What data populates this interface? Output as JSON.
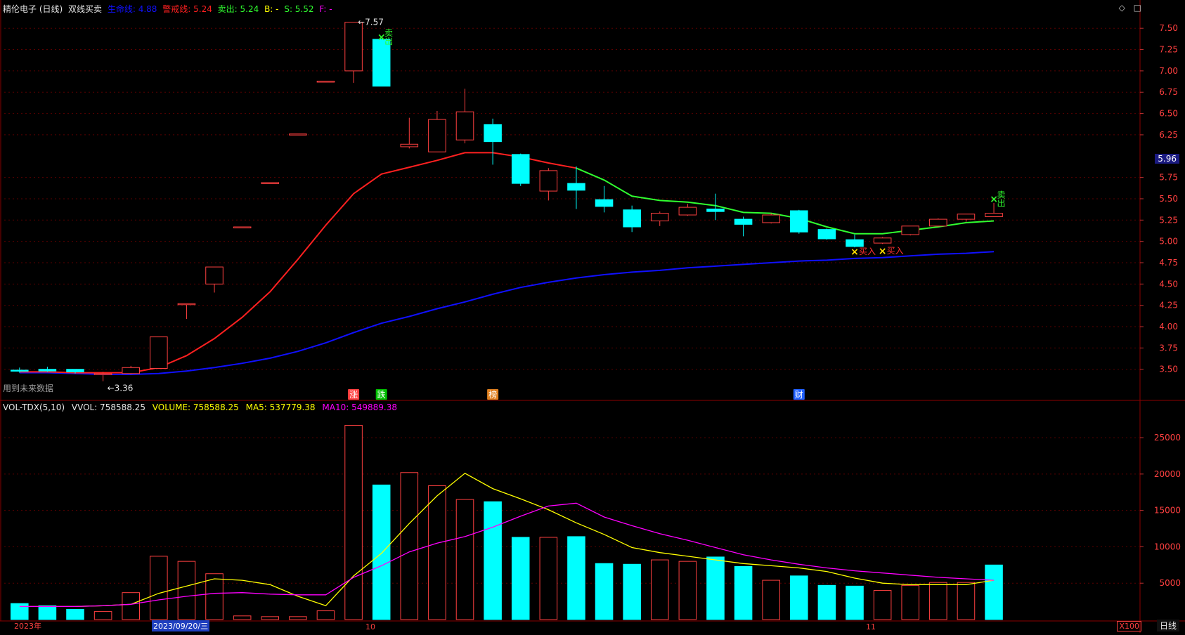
{
  "header": {
    "stock": "精伦电子 (日线)",
    "indicator": "双线买卖",
    "items": [
      {
        "label": "生命线: 4.88",
        "color": "#1010ff"
      },
      {
        "label": "警戒线: 5.24",
        "color": "#ff2020"
      },
      {
        "label": "卖出: 5.24",
        "color": "#30ff30"
      },
      {
        "label": "B: -",
        "color": "#ffff00"
      },
      {
        "label": "S: 5.52",
        "color": "#30ff30"
      },
      {
        "label": "F: -",
        "color": "#ff00ff"
      }
    ],
    "icons": [
      "diamond-icon",
      "square-icon"
    ]
  },
  "volume_header": {
    "name": "VOL-TDX(5,10)",
    "vvol": "VVOL: 758588.25",
    "volume": "VOLUME: 758588.25",
    "ma5": "MA5: 537779.38",
    "ma10": "MA10: 549889.38"
  },
  "note": "用到未来数据",
  "period": "日线",
  "scale": "X100",
  "current_price": "5.96",
  "dates": {
    "year": "2023年",
    "selected": "2023/09/20/三",
    "m10": "10",
    "m11": "11"
  },
  "colors": {
    "up": "#ff4040",
    "down": "#00ffff",
    "life_line": "#1010ff",
    "warn_red": "#ff2020",
    "warn_green": "#30ff30",
    "ma5": "#ffff00",
    "ma10": "#ff00ff"
  },
  "chart_data": [
    {
      "type": "candlestick",
      "ylim": [
        3.3,
        7.65
      ],
      "yticks": [
        "7.50",
        "7.25",
        "7.00",
        "6.75",
        "6.50",
        "6.25",
        "5.75",
        "5.50",
        "5.25",
        "5.00",
        "4.75",
        "4.50",
        "4.25",
        "4.00",
        "3.75",
        "3.50"
      ],
      "candles": [
        {
          "o": 3.49,
          "h": 3.52,
          "l": 3.46,
          "c": 3.48
        },
        {
          "o": 3.5,
          "h": 3.53,
          "l": 3.47,
          "c": 3.48
        },
        {
          "o": 3.5,
          "h": 3.5,
          "l": 3.45,
          "c": 3.47
        },
        {
          "o": 3.45,
          "h": 3.47,
          "l": 3.36,
          "c": 3.45
        },
        {
          "o": 3.45,
          "h": 3.54,
          "l": 3.44,
          "c": 3.52
        },
        {
          "o": 3.51,
          "h": 3.88,
          "l": 3.51,
          "c": 3.88
        },
        {
          "o": 4.27,
          "h": 4.27,
          "l": 4.09,
          "c": 4.27
        },
        {
          "o": 4.5,
          "h": 4.7,
          "l": 4.4,
          "c": 4.7
        },
        {
          "o": 5.17,
          "h": 5.17,
          "l": 5.17,
          "c": 5.17
        },
        {
          "o": 5.69,
          "h": 5.69,
          "l": 5.69,
          "c": 5.69
        },
        {
          "o": 6.26,
          "h": 6.26,
          "l": 6.26,
          "c": 6.26
        },
        {
          "o": 6.88,
          "h": 6.88,
          "l": 6.88,
          "c": 6.88
        },
        {
          "o": 7.0,
          "h": 7.57,
          "l": 6.86,
          "c": 7.57
        },
        {
          "o": 7.37,
          "h": 7.37,
          "l": 6.82,
          "c": 6.82
        },
        {
          "o": 6.11,
          "h": 6.45,
          "l": 6.09,
          "c": 6.14
        },
        {
          "o": 6.05,
          "h": 6.53,
          "l": 6.05,
          "c": 6.43
        },
        {
          "o": 6.19,
          "h": 6.79,
          "l": 6.15,
          "c": 6.52
        },
        {
          "o": 6.37,
          "h": 6.44,
          "l": 5.9,
          "c": 6.17
        },
        {
          "o": 6.02,
          "h": 6.03,
          "l": 5.65,
          "c": 5.68
        },
        {
          "o": 5.59,
          "h": 5.86,
          "l": 5.48,
          "c": 5.83
        },
        {
          "o": 5.68,
          "h": 5.88,
          "l": 5.38,
          "c": 5.6
        },
        {
          "o": 5.49,
          "h": 5.65,
          "l": 5.34,
          "c": 5.41
        },
        {
          "o": 5.37,
          "h": 5.42,
          "l": 5.11,
          "c": 5.17
        },
        {
          "o": 5.24,
          "h": 5.35,
          "l": 5.18,
          "c": 5.33
        },
        {
          "o": 5.31,
          "h": 5.44,
          "l": 5.3,
          "c": 5.4
        },
        {
          "o": 5.38,
          "h": 5.56,
          "l": 5.25,
          "c": 5.35
        },
        {
          "o": 5.26,
          "h": 5.29,
          "l": 5.06,
          "c": 5.2
        },
        {
          "o": 5.22,
          "h": 5.33,
          "l": 5.21,
          "c": 5.31
        },
        {
          "o": 5.36,
          "h": 5.37,
          "l": 5.09,
          "c": 5.11
        },
        {
          "o": 5.14,
          "h": 5.15,
          "l": 5.02,
          "c": 5.03
        },
        {
          "o": 5.02,
          "h": 5.08,
          "l": 4.93,
          "c": 4.94
        },
        {
          "o": 4.98,
          "h": 5.05,
          "l": 4.97,
          "c": 5.04
        },
        {
          "o": 5.08,
          "h": 5.18,
          "l": 5.07,
          "c": 5.18
        },
        {
          "o": 5.18,
          "h": 5.27,
          "l": 5.17,
          "c": 5.26
        },
        {
          "o": 5.26,
          "h": 5.32,
          "l": 5.23,
          "c": 5.32
        },
        {
          "o": 5.29,
          "h": 5.45,
          "l": 5.29,
          "c": 5.33
        }
      ],
      "series": [
        {
          "name": "生命线",
          "color": "#1010ff",
          "values": [
            3.46,
            3.46,
            3.45,
            3.44,
            3.44,
            3.45,
            3.48,
            3.52,
            3.57,
            3.63,
            3.71,
            3.81,
            3.93,
            4.04,
            4.12,
            4.21,
            4.29,
            4.38,
            4.46,
            4.52,
            4.57,
            4.61,
            4.64,
            4.66,
            4.69,
            4.71,
            4.73,
            4.75,
            4.77,
            4.78,
            4.8,
            4.81,
            4.83,
            4.85,
            4.86,
            4.88
          ]
        },
        {
          "name": "警戒线",
          "color": "#ff2020",
          "values": [
            3.47,
            3.47,
            3.46,
            3.46,
            3.46,
            3.52,
            3.66,
            3.86,
            4.11,
            4.41,
            4.79,
            5.19,
            5.56,
            5.79,
            5.87,
            5.95,
            6.04,
            6.04,
            5.99,
            5.92,
            5.86,
            null,
            null,
            null,
            null,
            null,
            null,
            null,
            null,
            null,
            null,
            null,
            null,
            null,
            null,
            null
          ]
        },
        {
          "name": "卖出",
          "color": "#30ff30",
          "values": [
            null,
            null,
            null,
            null,
            null,
            null,
            null,
            null,
            null,
            null,
            null,
            null,
            null,
            null,
            null,
            null,
            null,
            null,
            null,
            null,
            5.86,
            5.72,
            5.53,
            5.48,
            5.46,
            5.42,
            5.34,
            5.33,
            5.27,
            5.17,
            5.09,
            5.09,
            5.13,
            5.17,
            5.22,
            5.24
          ]
        }
      ],
      "signals": [
        {
          "index": 13,
          "kind": "sell",
          "label": "卖出",
          "price": 7.4
        },
        {
          "index": 35,
          "kind": "sell",
          "label": "卖出",
          "price": 5.5
        },
        {
          "index": 30,
          "kind": "buy",
          "label": "买入",
          "price": 4.88
        },
        {
          "index": 31,
          "kind": "buy",
          "label": "买入",
          "price": 4.89
        }
      ],
      "extremes": [
        {
          "index": 12,
          "label": "7.57",
          "price": 7.57
        },
        {
          "index": 3,
          "label": "3.36",
          "price": 3.36
        }
      ],
      "events": [
        {
          "index": 12,
          "label": "涨",
          "bg": "#ff4040",
          "fg": "#fff"
        },
        {
          "index": 13,
          "label": "跌",
          "bg": "#00c000",
          "fg": "#fff"
        },
        {
          "index": 17,
          "label": "榜",
          "bg": "#e08020",
          "fg": "#fff"
        },
        {
          "index": 28,
          "label": "财",
          "bg": "#2060ff",
          "fg": "#fff"
        }
      ]
    },
    {
      "type": "bar",
      "ylim": [
        0,
        28000
      ],
      "yticks": [
        "25000",
        "20000",
        "15000",
        "10000",
        "5000"
      ],
      "values": [
        2200,
        1900,
        1400,
        1100,
        3700,
        8700,
        8000,
        6300,
        500,
        400,
        400,
        1200,
        26700,
        18500,
        20200,
        18400,
        16500,
        16200,
        11300,
        11300,
        11400,
        7700,
        7600,
        8200,
        8000,
        8600,
        7300,
        5400,
        6000,
        4700,
        4600,
        4000,
        4700,
        5100,
        5100,
        7500
      ],
      "up": [
        false,
        false,
        false,
        true,
        true,
        true,
        true,
        true,
        true,
        true,
        true,
        true,
        true,
        false,
        true,
        true,
        true,
        false,
        false,
        true,
        false,
        false,
        false,
        true,
        true,
        false,
        false,
        true,
        false,
        false,
        false,
        true,
        true,
        true,
        true,
        false
      ],
      "series": [
        {
          "name": "MA5",
          "color": "#ffff00",
          "values": [
            1800,
            1800,
            1800,
            1900,
            2100,
            3600,
            4600,
            5600,
            5400,
            4800,
            3200,
            1900,
            6000,
            9100,
            13200,
            17000,
            20100,
            18000,
            16600,
            15100,
            13300,
            11700,
            9900,
            9200,
            8700,
            8200,
            7700,
            7400,
            7100,
            6600,
            5700,
            5000,
            4800,
            4800,
            4800,
            5400
          ]
        },
        {
          "name": "MA10",
          "color": "#ff00ff",
          "values": [
            1800,
            1800,
            1800,
            1900,
            2100,
            2700,
            3200,
            3600,
            3700,
            3500,
            3400,
            3400,
            5800,
            7400,
            9300,
            10500,
            11400,
            12700,
            14200,
            15600,
            16000,
            14100,
            12900,
            11800,
            10900,
            9900,
            8900,
            8200,
            7600,
            7100,
            6700,
            6400,
            6100,
            5800,
            5600,
            5400
          ]
        }
      ]
    }
  ]
}
